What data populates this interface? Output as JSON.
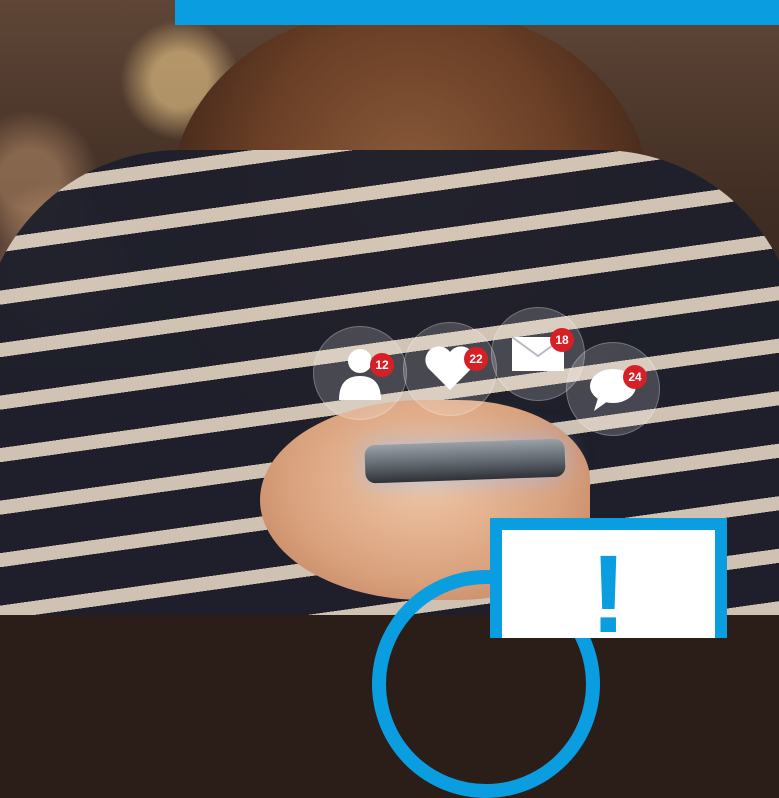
{
  "notifications": [
    {
      "icon": "user-icon",
      "count": "12"
    },
    {
      "icon": "heart-icon",
      "count": "22"
    },
    {
      "icon": "envelope-icon",
      "count": "18"
    },
    {
      "icon": "speech-bubble-icon",
      "count": "24"
    }
  ],
  "alert": {
    "symbol": "!"
  },
  "colors": {
    "accent_blue": "#0a9de0",
    "badge_red": "#d71f26"
  }
}
